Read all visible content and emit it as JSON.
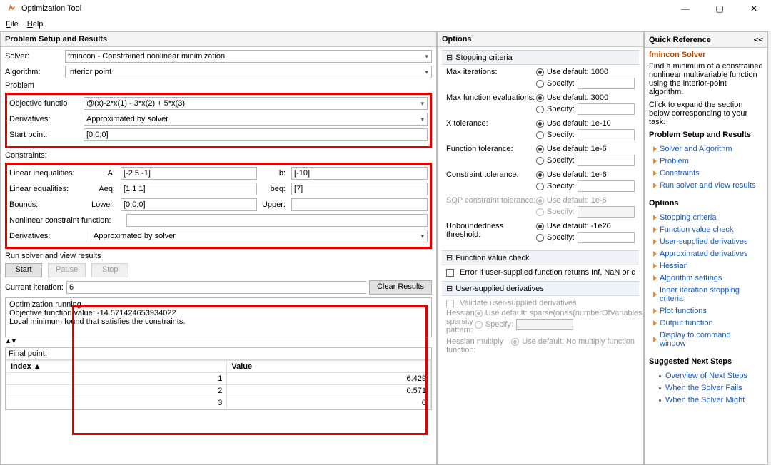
{
  "window": {
    "title": "Optimization Tool"
  },
  "menu": {
    "file": "File",
    "help": "Help"
  },
  "left": {
    "heading": "Problem Setup and Results",
    "solver_label": "Solver:",
    "solver_value": "fmincon - Constrained nonlinear minimization",
    "algorithm_label": "Algorithm:",
    "algorithm_value": "Interior point",
    "problem_group": "Problem",
    "objective_label": "Objective functio",
    "objective_value": "@(x)-2*x(1) - 3*x(2) + 5*x(3)",
    "derivs_label": "Derivatives:",
    "derivs_value": "Approximated by solver",
    "start_label": "Start point:",
    "start_value": "[0;0;0]",
    "constraints_group": "Constraints:",
    "lin_ineq": "Linear inequalities:",
    "lin_eq": "Linear equalities:",
    "bounds": "Bounds:",
    "A_lbl": "A:",
    "A_val": "[-2 5 -1]",
    "b_lbl": "b:",
    "b_val": "[-10]",
    "Aeq_lbl": "Aeq:",
    "Aeq_val": "[1 1 1]",
    "beq_lbl": "beq:",
    "beq_val": "[7]",
    "Lower_lbl": "Lower:",
    "Lower_val": "[0;0;0]",
    "Upper_lbl": "Upper:",
    "Upper_val": "",
    "nonlin_lbl": "Nonlinear constraint function:",
    "nonlin_val": "",
    "derivs2_label": "Derivatives:",
    "derivs2_value": "Approximated by solver",
    "run_section": "Run solver and view results",
    "start_btn": "Start",
    "pause_btn": "Pause",
    "stop_btn": "Stop",
    "iter_label": "Current iteration:",
    "iter_value": "6",
    "clear_btn": "Clear Results",
    "out_line1": "Optimization running.",
    "out_line2": "Objective function value: -14.571424653934022",
    "out_line3": "Local minimum found that satisfies the constraints.",
    "final_point": "Final point:",
    "fp_cols": {
      "index": "Index ▲",
      "value": "Value"
    },
    "fp_rows": [
      {
        "index": "1",
        "value": "6.429"
      },
      {
        "index": "2",
        "value": "0.571"
      },
      {
        "index": "3",
        "value": "0"
      }
    ]
  },
  "options": {
    "heading": "Options",
    "stopping": "Stopping criteria",
    "rows": {
      "maxiter": {
        "label": "Max iterations:",
        "def": "Use default: 1000",
        "spec": "Specify:"
      },
      "maxfun": {
        "label": "Max function evaluations:",
        "def": "Use default: 3000",
        "spec": "Specify:"
      },
      "xtol": {
        "label": "X tolerance:",
        "def": "Use default: 1e-10",
        "spec": "Specify:"
      },
      "ftol": {
        "label": "Function tolerance:",
        "def": "Use default: 1e-6",
        "spec": "Specify:"
      },
      "ctol": {
        "label": "Constraint tolerance:",
        "def": "Use default: 1e-6",
        "spec": "Specify:"
      },
      "sqp": {
        "label": "SQP constraint tolerance:",
        "def": "Use default: 1e-6",
        "spec": "Specify:"
      },
      "unb": {
        "label": "Unboundedness threshold:",
        "def": "Use default: -1e20",
        "spec": "Specify:"
      }
    },
    "fvc_head": "Function value check",
    "fvc_cb": "Error if user-supplied function returns Inf, NaN or complex",
    "usd_head": "User-supplied derivatives",
    "usd_cb": "Validate user-supplied derivatives",
    "hess_sp": {
      "label": "Hessian sparsity pattern:",
      "def": "Use default: sparse(ones(numberOfVariables))",
      "spec": "Specify:"
    },
    "hess_mf": {
      "label": "Hessian multiply function:",
      "def": "Use default: No multiply function"
    }
  },
  "qr": {
    "heading": "Quick Reference",
    "collapse": "<<",
    "solver_name": "fmincon Solver",
    "desc": "Find a minimum of a constrained nonlinear multivariable function using the interior-point algorithm.",
    "click": "Click to expand the section below corresponding to your task.",
    "psr": "Problem Setup and Results",
    "links_psr": [
      "Solver and Algorithm",
      "Problem",
      "Constraints",
      "Run solver and view results"
    ],
    "options_head": "Options",
    "links_opt": [
      "Stopping criteria",
      "Function value check",
      "User-supplied derivatives",
      "Approximated derivatives",
      "Hessian",
      "Algorithm settings",
      "Inner iteration stopping criteria",
      "Plot functions",
      "Output function",
      "Display to command window"
    ],
    "next_head": "Suggested Next Steps",
    "links_next": [
      "Overview of Next Steps",
      "When the Solver Fails",
      "When the Solver Might"
    ]
  }
}
